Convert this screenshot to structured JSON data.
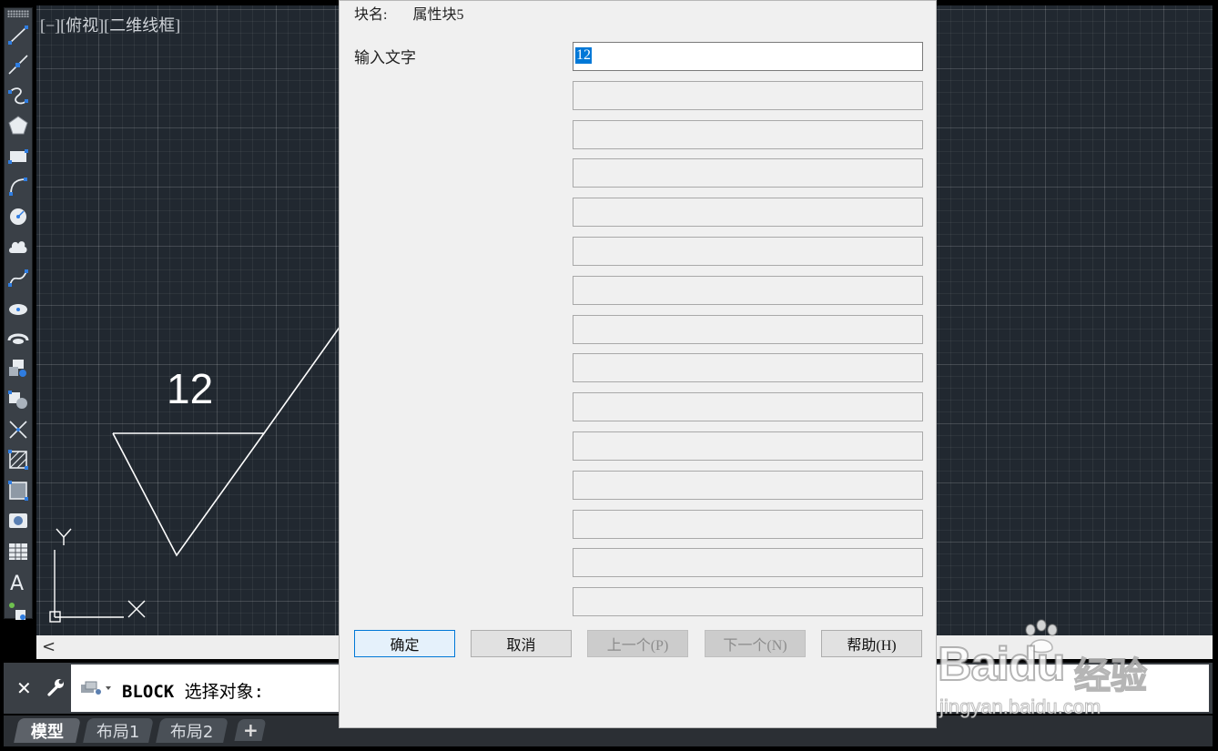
{
  "viewport": {
    "label": "[−][俯视][二维线框]"
  },
  "drawing": {
    "text": "12",
    "ucs_y_label": "Y",
    "ucs_x_label": "X"
  },
  "toolbar": {
    "tools": [
      {
        "name": "line-tool-icon"
      },
      {
        "name": "construction-line-tool-icon"
      },
      {
        "name": "polyline-tool-icon"
      },
      {
        "name": "polygon-tool-icon"
      },
      {
        "name": "rectangle-tool-icon"
      },
      {
        "name": "arc-tool-icon"
      },
      {
        "name": "circle-tool-icon"
      },
      {
        "name": "revision-cloud-tool-icon"
      },
      {
        "name": "spline-tool-icon"
      },
      {
        "name": "ellipse-tool-icon"
      },
      {
        "name": "ellipse-arc-tool-icon"
      },
      {
        "name": "insert-block-tool-icon"
      },
      {
        "name": "make-block-tool-icon"
      },
      {
        "name": "point-tool-icon"
      },
      {
        "name": "hatch-tool-icon"
      },
      {
        "name": "gradient-tool-icon"
      },
      {
        "name": "region-tool-icon"
      },
      {
        "name": "table-tool-icon"
      },
      {
        "name": "multiline-text-tool-icon"
      },
      {
        "name": "add-selected-tool-icon"
      }
    ]
  },
  "scrollbar": {
    "left_arrow": "<"
  },
  "command_line": {
    "close_glyph": "✕",
    "command": "BLOCK",
    "prompt": " 选择对象:"
  },
  "tabs": [
    {
      "label": "模型",
      "active": true
    },
    {
      "label": "布局1",
      "active": false
    },
    {
      "label": "布局2",
      "active": false
    }
  ],
  "tab_add_label": "+",
  "dialog": {
    "block_name_label": "块名:",
    "block_name_value": "属性块5",
    "prompt_label": "输入文字",
    "active_field_value": "12",
    "buttons": {
      "ok": "确定",
      "cancel": "取消",
      "previous": "上一个(P)",
      "next": "下一个(N)",
      "help": "帮助(H)"
    }
  },
  "watermark": {
    "brand": "Bai",
    "brand_tail": "du",
    "cn": "经验",
    "url": "jingyan.baidu.com"
  },
  "colors": {
    "canvas_bg": "#212830",
    "accent_blue": "#0078d7",
    "dialog_bg": "#f0f0f0"
  }
}
